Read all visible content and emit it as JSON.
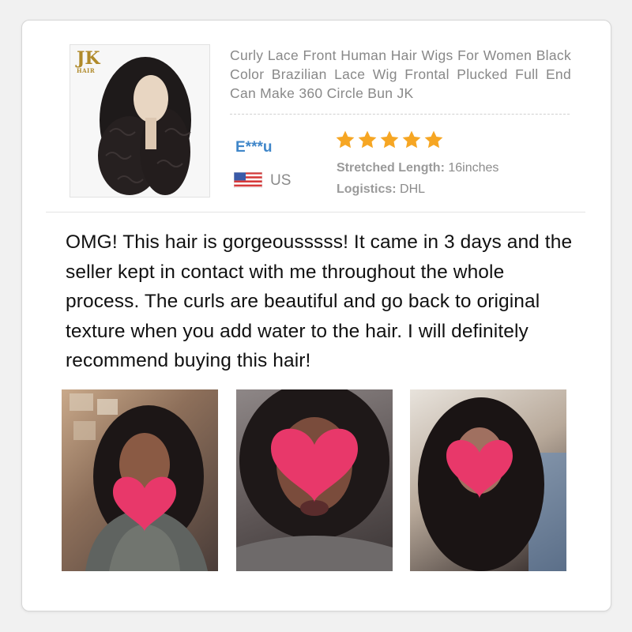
{
  "product": {
    "title": "Curly Lace Front Human Hair Wigs For Women Black Color Brazilian Lace Wig Frontal Plucked Full End Can Make 360 Circle Bun JK",
    "logo_text": "JK",
    "logo_subtext": "HAIR"
  },
  "reviewer": {
    "name": "E***u",
    "country": "US",
    "flag_icon": "us-flag-icon",
    "rating": 5,
    "rating_max": 5
  },
  "specs": {
    "length_label": "Stretched Length:",
    "length_value": "16inches",
    "logistics_label": "Logistics:",
    "logistics_value": "DHL"
  },
  "review": {
    "text": "OMG! This hair is gorgeousssss! It came in 3 days and the seller kept in contact with me throughout the whole process.  The curls are beautiful and go back to original texture when you add water to the hair. I will definitely recommend buying this hair!"
  },
  "colors": {
    "username": "#3f86c9",
    "star": "#f6a623",
    "heart": "#e8386a"
  },
  "photos": [
    {
      "icon": "customer-photo-1"
    },
    {
      "icon": "customer-photo-2"
    },
    {
      "icon": "customer-photo-3"
    }
  ]
}
